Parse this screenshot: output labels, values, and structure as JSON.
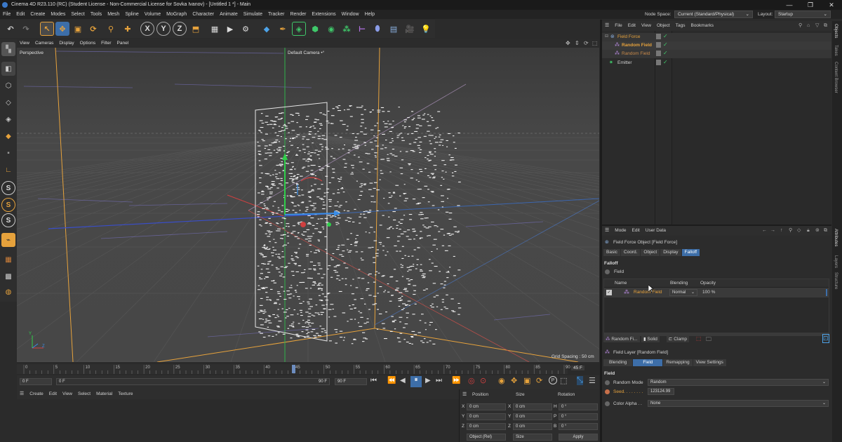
{
  "window": {
    "title": "Cinema 4D R23.110 (RC) (Student License - Non-Commercial License for Sovka Ivanov) - [Untitled 1 *] - Main",
    "min": "—",
    "max": "❐",
    "close": "✕"
  },
  "menubar": {
    "items": [
      "File",
      "Edit",
      "Create",
      "Modes",
      "Select",
      "Tools",
      "Mesh",
      "Spline",
      "Volume",
      "MoGraph",
      "Character",
      "Animate",
      "Simulate",
      "Tracker",
      "Render",
      "Extensions",
      "Window",
      "Help"
    ],
    "node_space_label": "Node Space:",
    "node_space_value": "Current (Standard/Physical)",
    "layout_label": "Layout:",
    "layout_value": "Startup"
  },
  "viewport": {
    "menu": [
      "View",
      "Cameras",
      "Display",
      "Options",
      "Filter",
      "Panel"
    ],
    "name": "Perspective",
    "camera": "Default Camera •°",
    "grid_spacing": "Grid Spacing : 50 cm"
  },
  "timeline": {
    "ticks": [
      "0",
      "5",
      "10",
      "15",
      "20",
      "25",
      "30",
      "35",
      "40",
      "45",
      "50",
      "55",
      "60",
      "65",
      "70",
      "75",
      "80",
      "85",
      "90"
    ],
    "current_frame_display": "45 F",
    "start": "0 F",
    "current": "0 F",
    "end_a": "90 F",
    "end_b": "90 F"
  },
  "material_panel": {
    "menu": [
      "Create",
      "Edit",
      "View",
      "Select",
      "Material",
      "Texture"
    ]
  },
  "coordinates": {
    "headers": [
      "Position",
      "Size",
      "Rotation"
    ],
    "rows": [
      {
        "axis": "X",
        "pos": "0 cm",
        "size_axis": "X",
        "size": "0 cm",
        "rot_axis": "H",
        "rot": "0 °"
      },
      {
        "axis": "Y",
        "pos": "0 cm",
        "size_axis": "Y",
        "size": "0 cm",
        "rot_axis": "P",
        "rot": "0 °"
      },
      {
        "axis": "Z",
        "pos": "0 cm",
        "size_axis": "Z",
        "size": "0 cm",
        "rot_axis": "B",
        "rot": "0 °"
      }
    ],
    "mode": "Object (Rel)",
    "size_mode": "Size",
    "apply": "Apply"
  },
  "object_manager": {
    "menu": [
      "File",
      "Edit",
      "View",
      "Object",
      "Tags",
      "Bookmarks"
    ],
    "items": [
      {
        "name": "Field Force",
        "color": "#e6a23c",
        "indent": 0
      },
      {
        "name": "Random Field",
        "color": "#e6a23c",
        "indent": 1
      },
      {
        "name": "Random Field",
        "color": "#c88a4a",
        "indent": 1
      },
      {
        "name": "Emitter",
        "color": "#cfcfcf",
        "indent": 0
      }
    ]
  },
  "attributes": {
    "menu": [
      "Mode",
      "Edit",
      "User Data"
    ],
    "object_title": "Field Force Object [Field Force]",
    "tabs": [
      "Basic",
      "Coord.",
      "Object",
      "Display",
      "Falloff"
    ],
    "active_tab": "Falloff",
    "section": "Falloff",
    "field_label": "Field",
    "list_headers": [
      "Name",
      "Blending",
      "Opacity"
    ],
    "list_row": {
      "name": "Random Field",
      "blending": "Normal",
      "opacity": "100 %"
    },
    "layer_buttons": [
      "Random Fi...",
      "Solid",
      "Clamp"
    ],
    "layer_title": "Field Layer [Random Field]",
    "layer_tabs": [
      "Blending",
      "Field",
      "Remapping",
      "View Settings"
    ],
    "active_layer_tab": "Field",
    "field_section": "Field",
    "random_mode_label": "Random Mode",
    "random_mode_value": "Random",
    "seed_label": "Seed. . . . . . . .",
    "seed_value": "123124.99",
    "color_alpha_label": "Color Alpha . .",
    "color_alpha_value": "None"
  },
  "side_tabs": {
    "top": [
      "Objects",
      "Takes",
      "Content Browser"
    ],
    "bottom": [
      "Attributes",
      "Layers",
      "Structure"
    ]
  }
}
